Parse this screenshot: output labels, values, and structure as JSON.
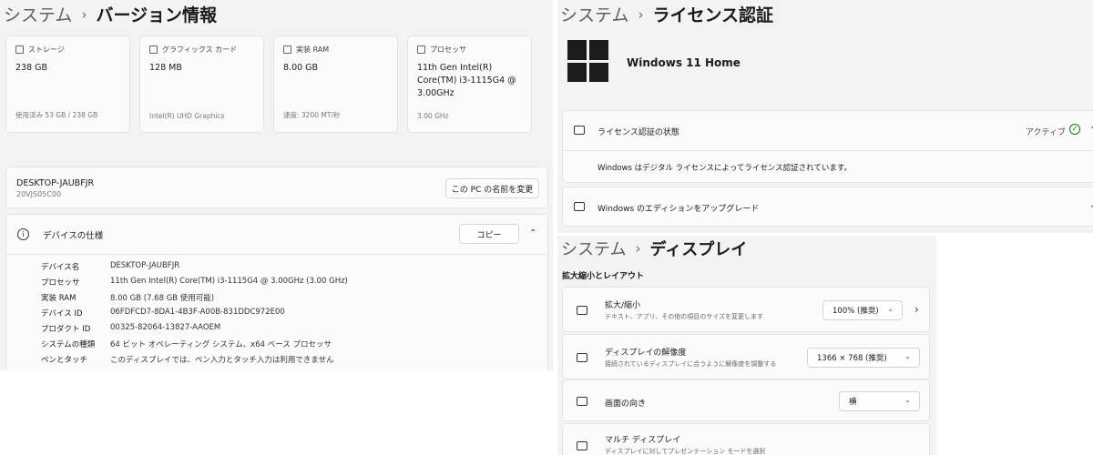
{
  "version_panel": {
    "breadcrumb_root": "システム",
    "breadcrumb_sep": "›",
    "breadcrumb_current": "バージョン情報",
    "specs": [
      {
        "label": "ストレージ",
        "value": "238 GB",
        "sub": "使用済み 53 GB / 238 GB"
      },
      {
        "label": "グラフィックス カード",
        "value": "128 MB",
        "sub": "Intel(R) UHD Graphics"
      },
      {
        "label": "実装 RAM",
        "value": "8.00 GB",
        "sub": "速度: 3200 MT/秒"
      },
      {
        "label": "プロセッサ",
        "value": "11th Gen Intel(R) Core(TM) i3-1115G4 @ 3.00GHz",
        "sub": "3.00 GHz"
      }
    ],
    "device_name": "DESKTOP-JAUBFJR",
    "device_model": "20VJS05C00",
    "rename_button": "この PC の名前を変更",
    "device_spec_title": "デバイスの仕様",
    "copy_button": "コピー",
    "spec_rows": [
      {
        "k": "デバイス名",
        "v": "DESKTOP-JAUBFJR"
      },
      {
        "k": "プロセッサ",
        "v": "11th Gen Intel(R) Core(TM) i3-1115G4 @ 3.00GHz (3.00 GHz)"
      },
      {
        "k": "実装 RAM",
        "v": "8.00 GB (7.68 GB 使用可能)"
      },
      {
        "k": "デバイス ID",
        "v": "06FDFCD7-8DA1-4B3F-A00B-831DDC972E00"
      },
      {
        "k": "プロダクト ID",
        "v": "00325-82064-13827-AAOEM"
      },
      {
        "k": "システムの種類",
        "v": "64 ビット オペレーティング システム、x64 ベース プロセッサ"
      },
      {
        "k": "ペンとタッチ",
        "v": "このディスプレイでは、ペン入力とタッチ入力は利用できません"
      }
    ]
  },
  "license_panel": {
    "breadcrumb_root": "システム",
    "breadcrumb_sep": "›",
    "breadcrumb_current": "ライセンス認証",
    "edition": "Windows 11 Home",
    "activation_state_label": "ライセンス認証の状態",
    "activation_state_value": "アクティブ",
    "activation_message": "Windows はデジタル ライセンスによってライセンス認証されています。",
    "upgrade_label": "Windows のエディションをアップグレード"
  },
  "display_panel": {
    "breadcrumb_root": "システム",
    "breadcrumb_sep": "›",
    "breadcrumb_current": "ディスプレイ",
    "section_title": "拡大縮小とレイアウト",
    "rows": [
      {
        "title": "拡大/縮小",
        "sub": "テキスト、アプリ、その他の項目のサイズを変更します",
        "value": "100% (推奨)"
      },
      {
        "title": "ディスプレイの解像度",
        "sub": "接続されているディスプレイに合うように解像度を調整する",
        "value": "1366 × 768 (推奨)"
      },
      {
        "title": "画面の向き",
        "sub": "",
        "value": "横"
      },
      {
        "title": "マルチ ディスプレイ",
        "sub": "ディスプレイに対してプレゼンテーション モードを選択",
        "value": ""
      }
    ]
  },
  "icons": {
    "chevron_up": "⌃",
    "chevron_down": "⌄",
    "chevron_right": "›",
    "check": "✓",
    "info": "i"
  },
  "colors": {
    "panel_bg": "#f3f3f3",
    "card_bg": "#fbfbfb",
    "active_check": "#0f7b0f"
  }
}
